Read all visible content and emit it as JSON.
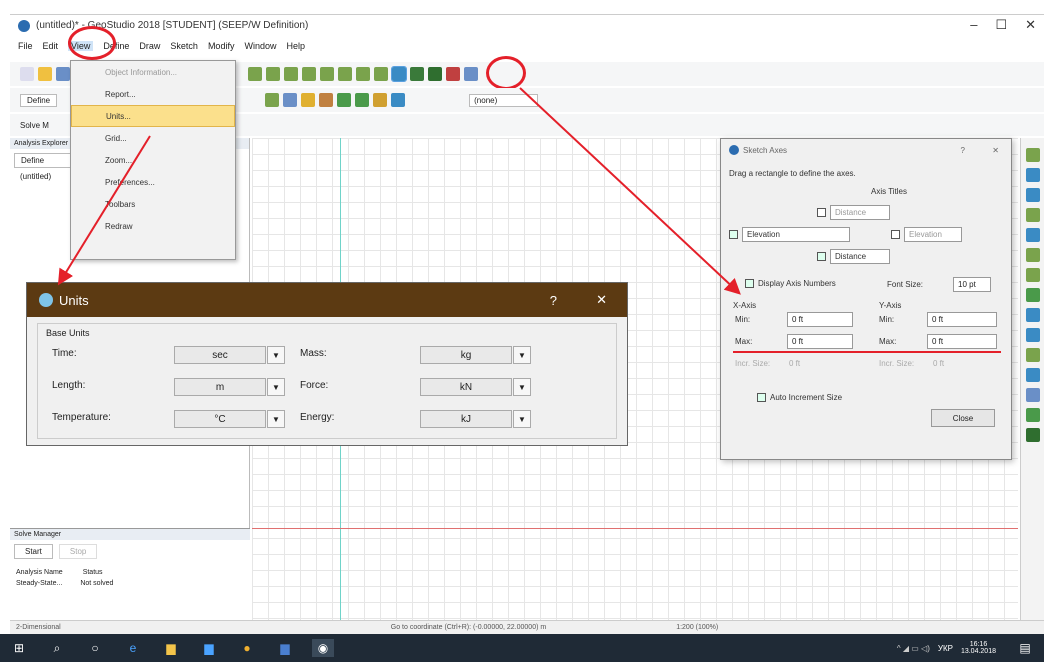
{
  "window": {
    "title": "(untitled)* - GeoStudio 2018 [STUDENT] (SEEP/W Definition)",
    "minimize": "–",
    "maximize": "☐",
    "close": "✕"
  },
  "menu": [
    "File",
    "Edit",
    "View",
    "Define",
    "Draw",
    "Sketch",
    "Modify",
    "Window",
    "Help"
  ],
  "toolbar": {
    "mode_label": "Define",
    "solve_label": "Solve M",
    "none_label": "(none)"
  },
  "view_menu": {
    "items": [
      {
        "label": "Object Information..."
      },
      {
        "label": "Report..."
      },
      {
        "label": "Units..."
      },
      {
        "label": "Grid..."
      },
      {
        "label": "Zoom..."
      },
      {
        "label": "Preferences..."
      },
      {
        "label": "Toolbars"
      },
      {
        "label": "Redraw"
      }
    ]
  },
  "left_panel": {
    "header": "Analysis Explorer",
    "define_btn": "Define",
    "tree_item": "(untitled)"
  },
  "units_dialog": {
    "title": "Units",
    "help": "?",
    "close": "✕",
    "group": "Base Units",
    "rows": [
      {
        "left_label": "Time:",
        "left_value": "sec",
        "right_label": "Mass:",
        "right_value": "kg"
      },
      {
        "left_label": "Length:",
        "left_value": "m",
        "right_label": "Force:",
        "right_value": "kN"
      },
      {
        "left_label": "Temperature:",
        "left_value": "°C",
        "right_label": "Energy:",
        "right_value": "kJ"
      }
    ]
  },
  "axes_dialog": {
    "title": "Sketch Axes",
    "help": "?",
    "close": "✕",
    "instruction": "Drag a rectangle to define the axes.",
    "axis_titles_label": "Axis Titles",
    "top_title": "Distance",
    "left_title": "Elevation",
    "right_title": "Elevation",
    "bottom_title": "Distance",
    "display_numbers": "Display Axis Numbers",
    "font_size_label": "Font Size:",
    "font_size_value": "10 pt",
    "x_axis": "X-Axis",
    "y_axis": "Y-Axis",
    "min_label": "Min:",
    "max_label": "Max:",
    "x_min": "0 ft",
    "x_max": "0 ft",
    "y_min": "0 ft",
    "y_max": "0 ft",
    "inc_label": "Incr. Size:",
    "inc_value": "0 ft",
    "auto_inc": "Auto Increment Size",
    "close_btn": "Close"
  },
  "solve_manager": {
    "title": "Solve Manager",
    "start": "Start",
    "stop": "Stop",
    "col_name": "Analysis Name",
    "col_status": "Status",
    "row_name": "Steady-State...",
    "row_status": "Not solved"
  },
  "statusbar": {
    "left": "2-Dimensional",
    "coords": "Go to coordinate (Ctrl+R): (-0.00000, 22.00000) m",
    "zoom": "1:200 (100%)"
  },
  "taskbar": {
    "time": "16:16",
    "date": "13.04.2018",
    "lang": "УКР"
  },
  "colors": {
    "annotation": "#e4202a",
    "units_header": "#5c3a12",
    "menu_highlight": "#fbe08c"
  }
}
